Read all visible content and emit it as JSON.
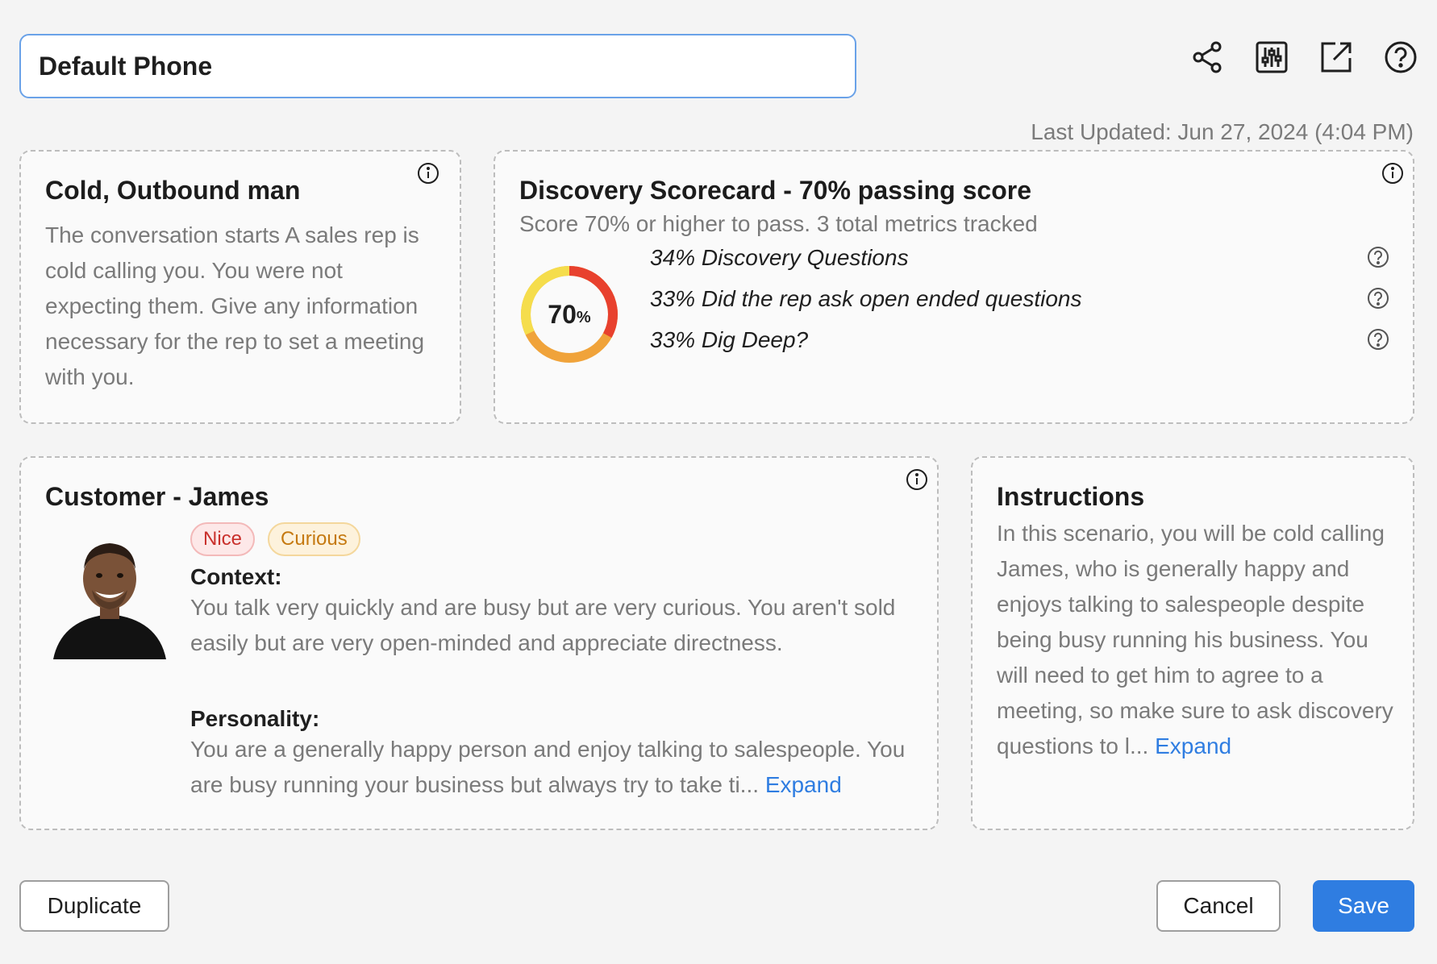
{
  "header": {
    "scenario_name": "Default Phone",
    "last_updated": "Last Updated: Jun 27, 2024 (4:04 PM)",
    "toolbar_icons": [
      "share-icon",
      "sliders-icon",
      "external-link-icon",
      "help-icon"
    ]
  },
  "persona_card": {
    "title": "Cold, Outbound man",
    "description": "The conversation starts A sales rep is cold calling you. You were not expecting them. Give any information necessary for the rep to set a meeting with you."
  },
  "scorecard": {
    "title": "Discovery Scorecard - 70% passing score",
    "subtitle": "Score 70% or higher to pass. 3 total metrics tracked",
    "passing_score_value": "70",
    "passing_score_unit": "%",
    "passing_score_fraction": 0.7,
    "metrics": [
      {
        "label": "34% Discovery Questions"
      },
      {
        "label": "33% Did the rep ask open ended questions"
      },
      {
        "label": "33% Dig Deep?"
      }
    ],
    "colors": {
      "red": "#e8412e",
      "orange": "#f0a33a",
      "yellow": "#f5dd4c"
    }
  },
  "customer_card": {
    "title": "Customer - James",
    "tags": [
      {
        "label": "Nice",
        "color": "#c9302c"
      },
      {
        "label": "Curious",
        "color": "#c57910"
      }
    ],
    "context_label": "Context:",
    "context_text": "You talk very quickly and are busy but are very curious. You aren't sold easily but are very open-minded and appreciate directness.",
    "personality_label": "Personality:",
    "personality_text": "You are a generally happy person and enjoy talking to salespeople. You are busy running your business but always try to take ti...",
    "expand_label": "Expand"
  },
  "instructions_card": {
    "title": "Instructions",
    "text": "In this scenario, you will be cold calling James, who is generally happy and enjoys talking to salespeople despite being busy running his business. You will need to get him to agree to a meeting, so make sure to ask discovery questions to l...",
    "expand_label": "Expand"
  },
  "footer": {
    "duplicate_label": "Duplicate",
    "cancel_label": "Cancel",
    "save_label": "Save"
  },
  "accent_color": "#2f7de1"
}
